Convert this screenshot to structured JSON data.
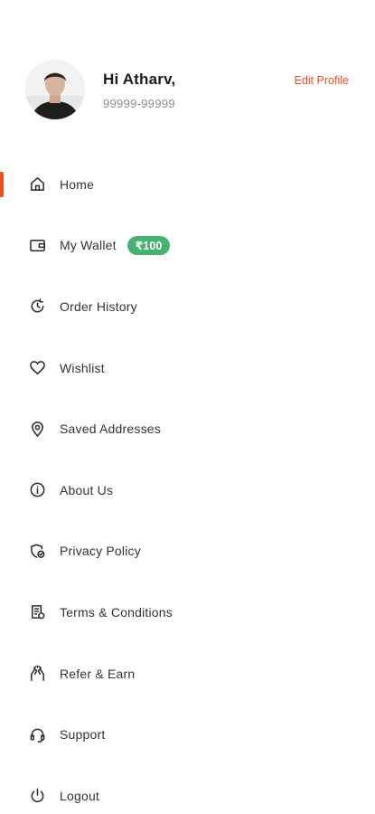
{
  "profile": {
    "greeting": "Hi Atharv,",
    "phone": "99999-99999",
    "edit_label": "Edit Profile"
  },
  "colors": {
    "accent": "#ef4e22",
    "badge": "#46b36e"
  },
  "menu": {
    "items": [
      {
        "label": "Home",
        "icon": "home-icon",
        "active": true
      },
      {
        "label": "My Wallet",
        "icon": "wallet-icon",
        "badge": "₹100"
      },
      {
        "label": "Order History",
        "icon": "history-icon"
      },
      {
        "label": "Wishlist",
        "icon": "heart-icon"
      },
      {
        "label": "Saved Addresses",
        "icon": "location-pin-icon"
      },
      {
        "label": "About Us",
        "icon": "info-icon"
      },
      {
        "label": "Privacy Policy",
        "icon": "privacy-shield-icon"
      },
      {
        "label": "Terms & Conditions",
        "icon": "document-icon"
      },
      {
        "label": "Refer & Earn",
        "icon": "refer-hands-icon"
      },
      {
        "label": "Support",
        "icon": "headset-icon"
      },
      {
        "label": "Logout",
        "icon": "power-icon"
      }
    ]
  }
}
